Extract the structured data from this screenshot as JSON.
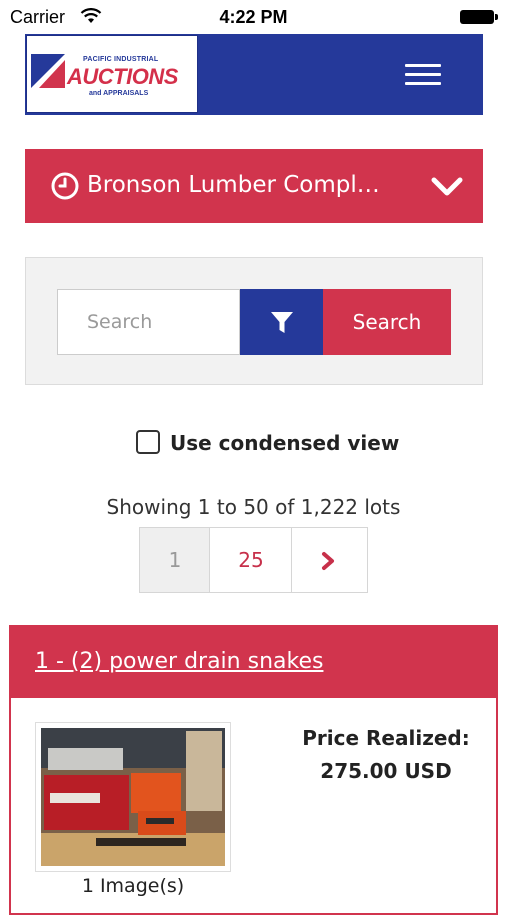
{
  "status_bar": {
    "carrier": "Carrier",
    "time": "4:22 PM",
    "icons": [
      "wifi-icon",
      "battery-icon"
    ]
  },
  "header": {
    "logo": {
      "top_text": "PACIFIC INDUSTRIAL",
      "main_text": "AUCTIONS",
      "sub_text": "and APPRAISALS"
    },
    "menu_icon": "hamburger-menu-icon",
    "brand_blue": "#25399a",
    "brand_red": "#d1344d"
  },
  "auction_select": {
    "icon": "clock-icon",
    "title": "Bronson Lumber Compl…",
    "chevron": "chevron-down-icon"
  },
  "search": {
    "placeholder": "Search",
    "filter_icon": "filter-icon",
    "button_label": "Search"
  },
  "condensed_view": {
    "label": "Use condensed view",
    "checked": false
  },
  "results": {
    "summary": "Showing 1 to 50 of 1,222 lots"
  },
  "pagination": {
    "pages": [
      "1",
      "25"
    ],
    "next_icon": "chevron-right-icon"
  },
  "lot": {
    "title": "1 - (2) power drain snakes",
    "images_label": "1 Image(s)",
    "price_label": "Price Realized:",
    "price_value": "275.00 USD"
  }
}
